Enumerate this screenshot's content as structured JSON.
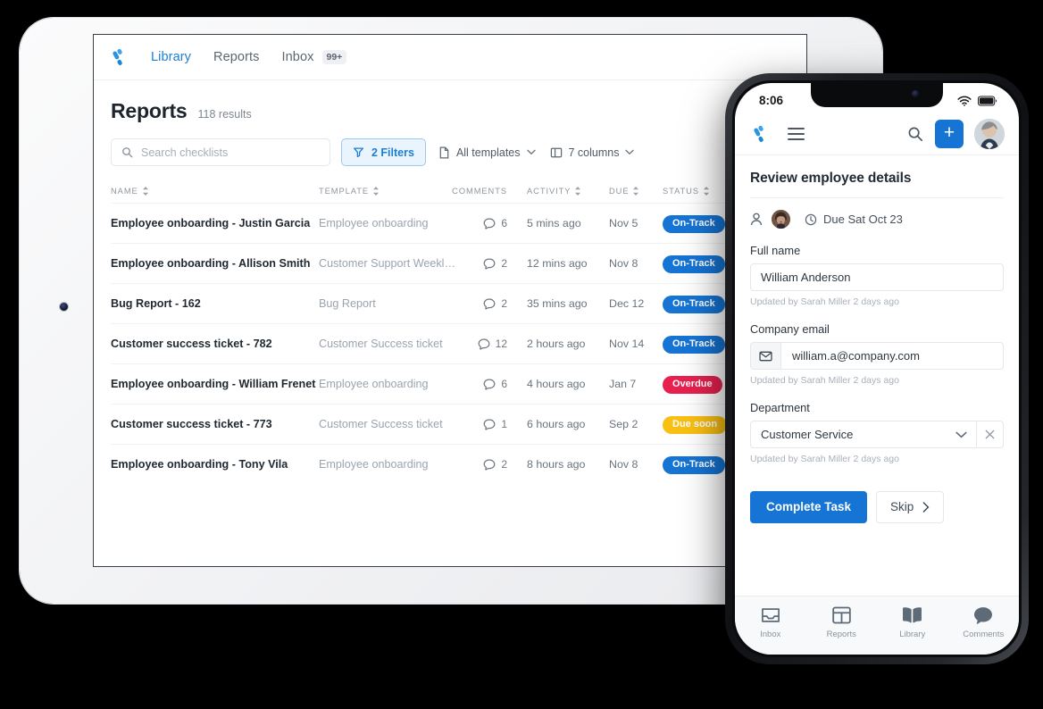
{
  "tablet": {
    "nav": {
      "logo_icon": "process-street-logo-icon",
      "links": [
        {
          "label": "Library",
          "active": true
        },
        {
          "label": "Reports",
          "active": false
        },
        {
          "label": "Inbox",
          "active": false,
          "badge": "99+"
        }
      ]
    },
    "page": {
      "title": "Reports",
      "results": "118 results"
    },
    "toolbar": {
      "search_placeholder": "Search checklists",
      "filters_label": "2 Filters",
      "templates_label": "All templates",
      "columns_label": "7 columns"
    },
    "table": {
      "columns": [
        {
          "key": "name",
          "label": "NAME",
          "sortable": true
        },
        {
          "key": "template",
          "label": "TEMPLATE",
          "sortable": true
        },
        {
          "key": "comments",
          "label": "COMMENTS",
          "sortable": false
        },
        {
          "key": "activity",
          "label": "ACTIVITY",
          "sortable": true
        },
        {
          "key": "due",
          "label": "DUE",
          "sortable": true
        },
        {
          "key": "status",
          "label": "STATUS",
          "sortable": true
        }
      ],
      "rows": [
        {
          "name": "Employee onboarding - Justin Garcia",
          "template": "Employee onboarding",
          "comments": "6",
          "activity": "5 mins ago",
          "due": "Nov 5",
          "status": "On-Track",
          "status_kind": "ontrack"
        },
        {
          "name": "Employee onboarding - Allison Smith",
          "template": "Customer Support Weekl…",
          "comments": "2",
          "activity": "12 mins ago",
          "due": "Nov 8",
          "status": "On-Track",
          "status_kind": "ontrack"
        },
        {
          "name": "Bug Report - 162",
          "template": "Bug Report",
          "comments": "2",
          "activity": "35 mins ago",
          "due": "Dec 12",
          "status": "On-Track",
          "status_kind": "ontrack"
        },
        {
          "name": "Customer success ticket - 782",
          "template": "Customer Success ticket",
          "comments": "12",
          "activity": "2 hours ago",
          "due": "Nov 14",
          "status": "On-Track",
          "status_kind": "ontrack"
        },
        {
          "name": "Employee onboarding - William Frenet",
          "template": "Employee onboarding",
          "comments": "6",
          "activity": "4 hours ago",
          "due": "Jan 7",
          "status": "Overdue",
          "status_kind": "overdue"
        },
        {
          "name": "Customer success ticket - 773",
          "template": "Customer Success ticket",
          "comments": "1",
          "activity": "6 hours ago",
          "due": "Sep 2",
          "status": "Due soon",
          "status_kind": "duesoon"
        },
        {
          "name": "Employee onboarding - Tony Vila",
          "template": "Employee onboarding",
          "comments": "2",
          "activity": "8 hours ago",
          "due": "Nov 8",
          "status": "On-Track",
          "status_kind": "ontrack"
        }
      ]
    }
  },
  "phone": {
    "status_bar": {
      "time": "8:06",
      "wifi_icon": "wifi-icon",
      "battery_icon": "battery-full-icon"
    },
    "nav": {
      "logo_icon": "process-street-logo-icon",
      "menu_icon": "hamburger-menu-icon",
      "search_icon": "search-icon",
      "add_label": "+",
      "avatar_icon": "user-avatar"
    },
    "task": {
      "title": "Review employee details",
      "assignee_icon": "person-icon",
      "due_label": "Due Sat Oct 23"
    },
    "fields": [
      {
        "label": "Full name",
        "value": "William Anderson",
        "hint": "Updated by Sarah Miller 2 days ago",
        "type": "text"
      },
      {
        "label": "Company email",
        "value": "william.a@company.com",
        "hint": "Updated by Sarah Miller 2 days ago",
        "type": "email",
        "icon": "envelope-icon"
      },
      {
        "label": "Department",
        "value": "Customer Service",
        "hint": "Updated by Sarah Miller 2 days ago",
        "type": "select"
      }
    ],
    "actions": {
      "complete_label": "Complete Task",
      "skip_label": "Skip"
    },
    "tabbar": [
      {
        "label": "Inbox",
        "icon": "inbox-icon"
      },
      {
        "label": "Reports",
        "icon": "grid-icon"
      },
      {
        "label": "Library",
        "icon": "book-icon"
      },
      {
        "label": "Comments",
        "icon": "comment-icon"
      }
    ]
  },
  "colors": {
    "brand_blue": "#1574d4",
    "link_blue": "#1b7fd4",
    "overdue_red": "#e8204f",
    "duesoon_yellow": "#f9bf14",
    "text_dark": "#1f2830",
    "text_muted": "#9aa4af"
  }
}
